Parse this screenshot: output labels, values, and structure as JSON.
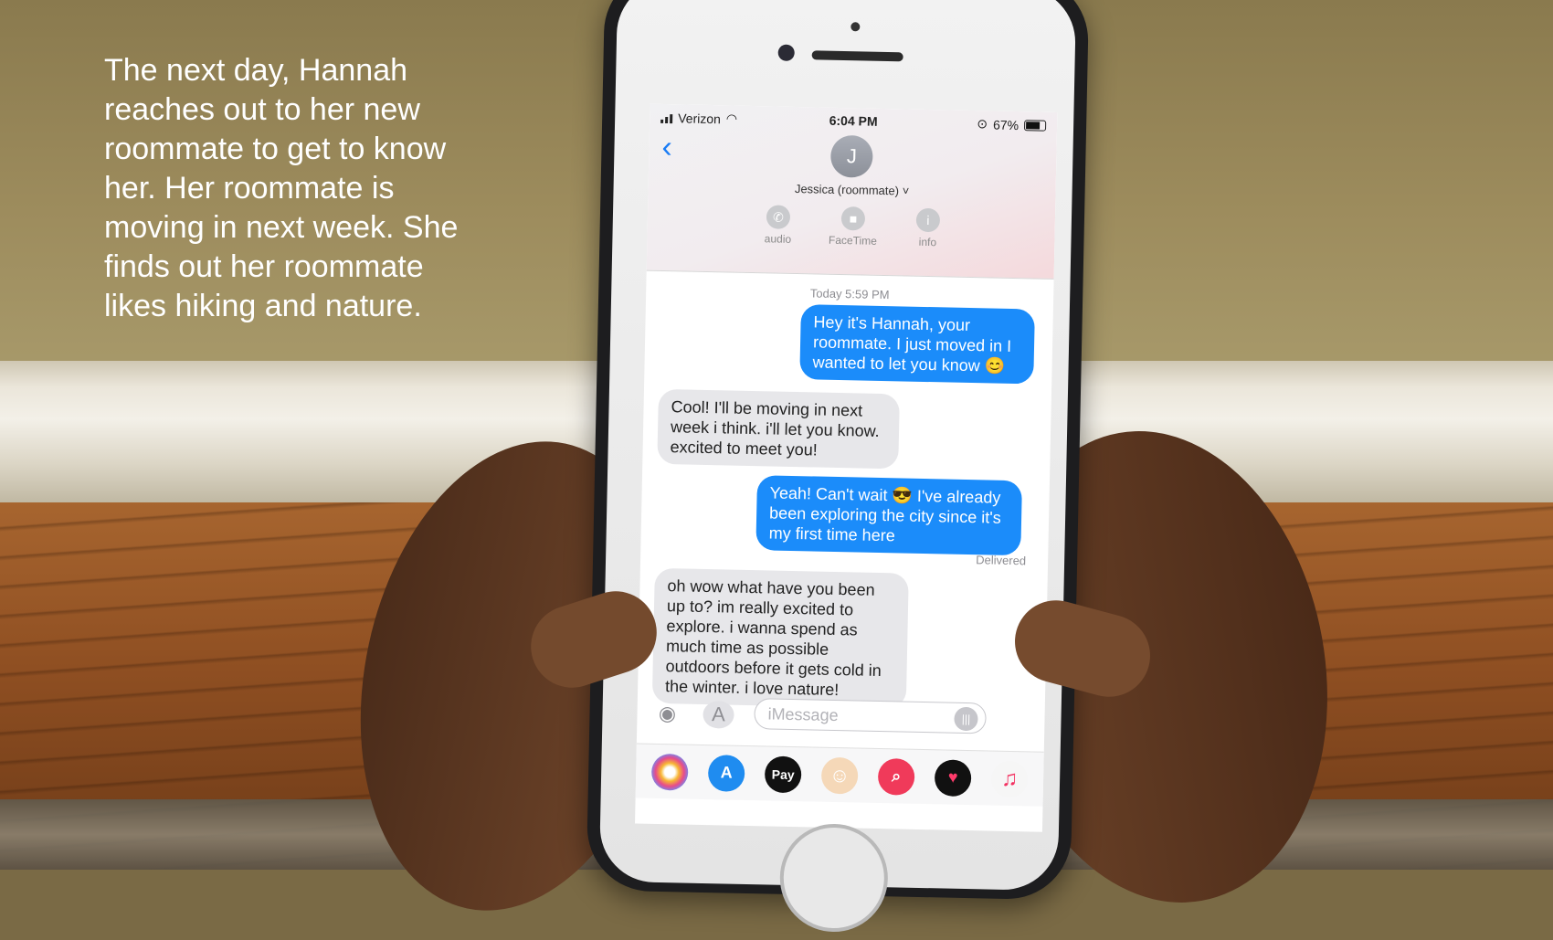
{
  "caption": "The next day, Hannah reaches out to her new roommate to get to know her. Her roommate is moving in next week. She finds out her roommate likes hiking and nature.",
  "status_bar": {
    "carrier": "Verizon",
    "time": "6:04 PM",
    "battery": "67%",
    "battery_level": 0.67
  },
  "contact": {
    "initial": "J",
    "name": "Jessica (roommate)"
  },
  "actions": {
    "audio": "audio",
    "facetime": "FaceTime",
    "info": "info"
  },
  "conversation": {
    "timestamp": "Today 5:59 PM",
    "messages": [
      {
        "from": "me",
        "text": "Hey it's Hannah, your roommate. I just moved in I wanted to let you know 😊"
      },
      {
        "from": "them",
        "text": "Cool! I'll be moving in next week i think. i'll let you know. excited to meet you!"
      },
      {
        "from": "me",
        "text": "Yeah! Can't wait 😎 I've already been exploring the city since it's my first time here"
      },
      {
        "from": "them",
        "text": "oh wow what have you been up to? im really excited to explore. i wanna spend as much time as possible outdoors before it gets cold in the winter. i love nature!"
      }
    ],
    "delivered": "Delivered"
  },
  "input": {
    "placeholder": "iMessage"
  },
  "app_drawer": {
    "apps": [
      "photos-icon",
      "app-store-icon",
      "apple-pay-icon",
      "memoji-icon",
      "web-search-icon",
      "digital-touch-icon",
      "music-icon"
    ],
    "apple_pay_label": "Pay"
  },
  "colors": {
    "outgoing_bubble": "#1b8cfa",
    "incoming_bubble": "#e7e7ea",
    "accent": "#1a7cf5"
  }
}
